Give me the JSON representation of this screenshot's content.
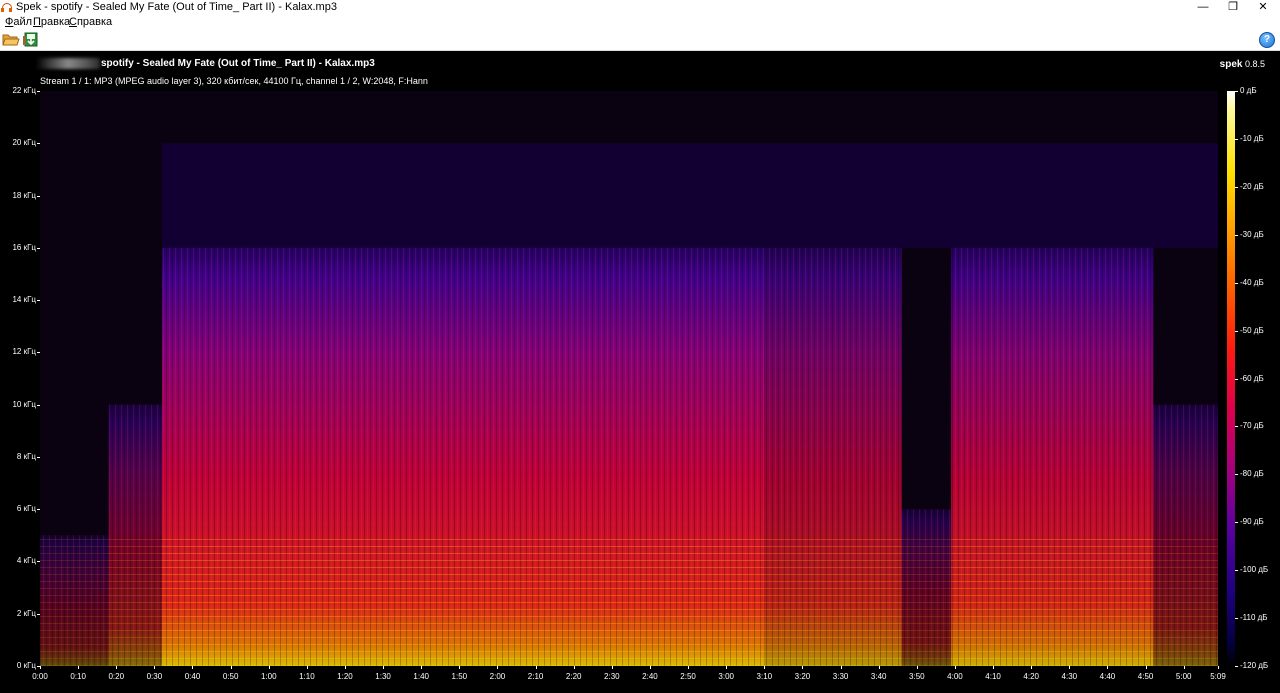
{
  "window": {
    "title": "Spek - spotify - Sealed My Fate (Out of Time_ Part II) - Kalax.mp3",
    "minimize": "—",
    "maximize": "❐",
    "close": "✕"
  },
  "menu": [
    {
      "u": "Ф",
      "rest": "айл"
    },
    {
      "u": "П",
      "rest": "равка"
    },
    {
      "u": "С",
      "rest": "правка"
    }
  ],
  "toolbar": {
    "open_icon": "folder-open-icon",
    "save_icon": "save-image-icon",
    "help_icon": "help-icon",
    "help_glyph": "?"
  },
  "spek": {
    "file_title": "spotify - Sealed My Fate (Out of Time_ Part II) - Kalax.mp3",
    "stream_info": "Stream 1 / 1: MP3 (MPEG audio layer 3), 320 кбит/сек, 44100 Гц, channel 1 / 2, W:2048, F:Hann",
    "brand_name": "spek",
    "brand_version": "0.8.5"
  },
  "colors": {
    "background": "#000000",
    "palette_low": "#0a0020",
    "palette_mid": "#d0003c",
    "palette_high": "#ffe000"
  },
  "chart_data": {
    "type": "heatmap",
    "xlabel": "",
    "ylabel": "",
    "x_range_seconds": [
      0,
      309
    ],
    "y_range_khz": [
      0,
      22
    ],
    "db_range": [
      -120,
      0
    ],
    "x_ticks": [
      "0:00",
      "0:10",
      "0:20",
      "0:30",
      "0:40",
      "0:50",
      "1:00",
      "1:10",
      "1:20",
      "1:30",
      "1:40",
      "1:50",
      "2:00",
      "2:10",
      "2:20",
      "2:30",
      "2:40",
      "2:50",
      "3:00",
      "3:10",
      "3:20",
      "3:30",
      "3:40",
      "3:50",
      "4:00",
      "4:10",
      "4:20",
      "4:30",
      "4:40",
      "4:50",
      "5:00",
      "5:09"
    ],
    "x_tick_seconds": [
      0,
      10,
      20,
      30,
      40,
      50,
      60,
      70,
      80,
      90,
      100,
      110,
      120,
      130,
      140,
      150,
      160,
      170,
      180,
      190,
      200,
      210,
      220,
      230,
      240,
      250,
      260,
      270,
      280,
      290,
      300,
      309
    ],
    "y_ticks": [
      "0 кГц",
      "2 кГц",
      "4 кГц",
      "6 кГц",
      "8 кГц",
      "10 кГц",
      "12 кГц",
      "14 кГц",
      "16 кГц",
      "18 кГц",
      "20 кГц",
      "22 кГц"
    ],
    "y_tick_khz": [
      0,
      2,
      4,
      6,
      8,
      10,
      12,
      14,
      16,
      18,
      20,
      22
    ],
    "legend_labels": [
      "0 дБ",
      "-10 дБ",
      "-20 дБ",
      "-30 дБ",
      "-40 дБ",
      "-50 дБ",
      "-60 дБ",
      "-70 дБ",
      "-80 дБ",
      "-90 дБ",
      "-100 дБ",
      "-110 дБ",
      "-120 дБ"
    ],
    "legend_db": [
      0,
      -10,
      -20,
      -30,
      -40,
      -50,
      -60,
      -70,
      -80,
      -90,
      -100,
      -110,
      -120
    ],
    "sections": [
      {
        "start_s": 0,
        "end_s": 18,
        "cutoff_khz": 5,
        "energy": 0.35
      },
      {
        "start_s": 18,
        "end_s": 32,
        "cutoff_khz": 10,
        "energy": 0.5
      },
      {
        "start_s": 32,
        "end_s": 190,
        "cutoff_khz": 16,
        "energy": 0.85
      },
      {
        "start_s": 190,
        "end_s": 226,
        "cutoff_khz": 16,
        "energy": 0.7
      },
      {
        "start_s": 226,
        "end_s": 239,
        "cutoff_khz": 6,
        "energy": 0.4
      },
      {
        "start_s": 239,
        "end_s": 292,
        "cutoff_khz": 16,
        "energy": 0.8
      },
      {
        "start_s": 292,
        "end_s": 309,
        "cutoff_khz": 10,
        "energy": 0.45
      }
    ]
  }
}
